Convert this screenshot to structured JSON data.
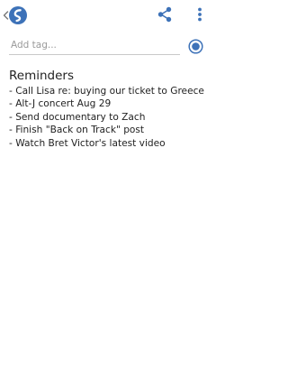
{
  "toolbar": {
    "back_icon": "chevron-left-icon",
    "logo_icon": "simplenote-logo",
    "share_icon": "share-icon",
    "overflow_icon": "more-vertical-icon",
    "icon_color": "#3d72b8"
  },
  "tags": {
    "placeholder": "Add tag...",
    "value": "",
    "sync_icon": "sync-status-icon",
    "sync_color": "#3d72b8"
  },
  "note": {
    "title": "Reminders",
    "lines": [
      "- Call Lisa re: buying our ticket to Greece",
      "- Alt-J concert Aug 29",
      "- Send documentary to Zach",
      "- Finish \"Back on Track\" post",
      "- Watch Bret Victor's latest video"
    ]
  }
}
